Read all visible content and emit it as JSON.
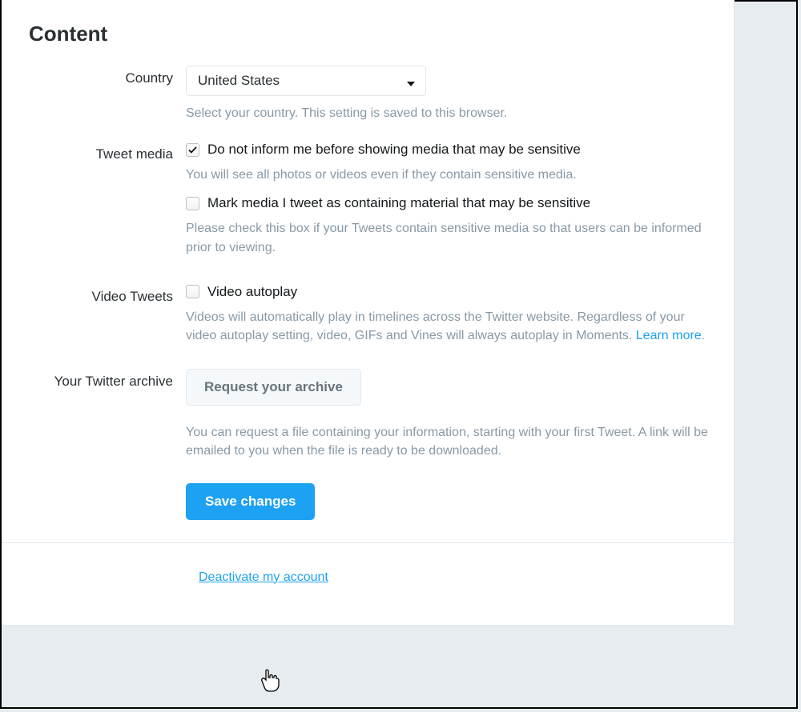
{
  "heading": "Content",
  "country": {
    "label": "Country",
    "selected": "United States",
    "help": "Select your country. This setting is saved to this browser."
  },
  "tweet_media": {
    "label": "Tweet media",
    "opt1_label": "Do not inform me before showing media that may be sensitive",
    "opt1_checked": true,
    "opt1_help": "You will see all photos or videos even if they contain sensitive media.",
    "opt2_label": "Mark media I tweet as containing material that may be sensitive",
    "opt2_checked": false,
    "opt2_help": "Please check this box if your Tweets contain sensitive media so that users can be informed prior to viewing."
  },
  "video_tweets": {
    "label": "Video Tweets",
    "autoplay_label": "Video autoplay",
    "autoplay_checked": false,
    "help_pre": "Videos will automatically play in timelines across the Twitter website. Regardless of your video autoplay setting, video, GIFs and Vines will always autoplay in Moments. ",
    "learn_more": "Learn more",
    "help_post": "."
  },
  "archive": {
    "label": "Your Twitter archive",
    "button": "Request your archive",
    "help": "You can request a file containing your information, starting with your first Tweet. A link will be emailed to you when the file is ready to be downloaded."
  },
  "save_button": "Save changes",
  "deactivate_link": "Deactivate my account"
}
